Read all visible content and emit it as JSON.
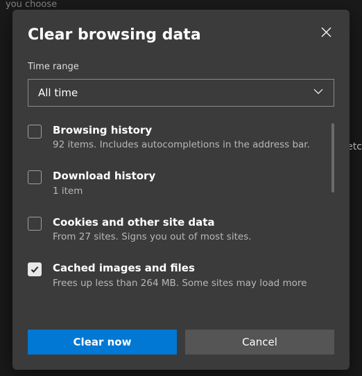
{
  "background": {
    "hint_top": "you choose",
    "hint_right": "etc"
  },
  "dialog": {
    "title": "Clear browsing data",
    "time_range_label": "Time range",
    "time_range_value": "All time",
    "items": [
      {
        "title": "Browsing history",
        "sub": "92 items. Includes autocompletions in the address bar.",
        "checked": false
      },
      {
        "title": "Download history",
        "sub": "1 item",
        "checked": false
      },
      {
        "title": "Cookies and other site data",
        "sub": "From 27 sites. Signs you out of most sites.",
        "checked": false
      },
      {
        "title": "Cached images and files",
        "sub": "Frees up less than 264 MB. Some sites may load more",
        "checked": true
      }
    ],
    "primary_button": "Clear now",
    "secondary_button": "Cancel"
  }
}
